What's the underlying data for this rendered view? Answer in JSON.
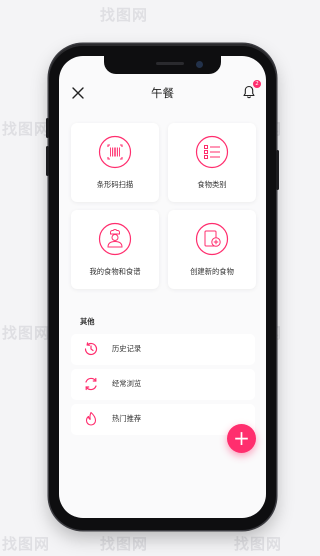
{
  "header": {
    "title": "午餐",
    "notification_count": "2"
  },
  "cards": [
    {
      "label": "条形码扫描",
      "icon": "barcode-icon"
    },
    {
      "label": "食物类别",
      "icon": "category-list-icon"
    },
    {
      "label": "我的食物和食谱",
      "icon": "chef-icon"
    },
    {
      "label": "创建新的食物",
      "icon": "add-food-icon"
    }
  ],
  "section": {
    "title": "其他"
  },
  "list": [
    {
      "label": "历史记录",
      "icon": "history-icon"
    },
    {
      "label": "经常浏览",
      "icon": "refresh-icon"
    },
    {
      "label": "热门推荐",
      "icon": "fire-icon"
    }
  ],
  "fab": {
    "label": "+"
  },
  "colors": {
    "accent": "#ff2e6e",
    "card_bg": "#ffffff",
    "screen_bg": "#fafafb"
  },
  "watermark": "找图网"
}
